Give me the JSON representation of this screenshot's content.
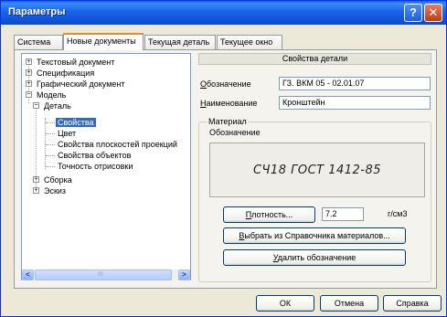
{
  "window": {
    "title": "Параметры"
  },
  "titlebar": {
    "help_label": "?",
    "close_label": "✕"
  },
  "tabs": [
    {
      "label": "Система"
    },
    {
      "label": "Новые документы"
    },
    {
      "label": "Текущая деталь"
    },
    {
      "label": "Текущее окно"
    }
  ],
  "tree": {
    "items": [
      {
        "label": "Текстовый документ",
        "expander": "+"
      },
      {
        "label": "Спецификация",
        "expander": "+"
      },
      {
        "label": "Графический документ",
        "expander": "+"
      },
      {
        "label": "Модель",
        "expander": "−"
      },
      {
        "label": "Деталь",
        "expander": "−"
      },
      {
        "label": "Свойства"
      },
      {
        "label": "Цвет"
      },
      {
        "label": "Свойства плоскостей проекций"
      },
      {
        "label": "Свойства объектов"
      },
      {
        "label": "Точность отрисовки"
      },
      {
        "label": "Сборка",
        "expander": "+"
      },
      {
        "label": "Эскиз",
        "expander": "+"
      }
    ],
    "selected": "Свойства"
  },
  "scrollbar": {
    "left_arrow": "<",
    "right_arrow": ">",
    "thumb_grip": "III"
  },
  "props": {
    "header": "Свойства детали",
    "designation_label_first": "О",
    "designation_label_rest": "бозначение",
    "designation_value": "ГЗ. ВКМ 05 - 02.01.07",
    "name_label_first": "Н",
    "name_label_rest": "аименование",
    "name_value": "Кронштейн"
  },
  "material": {
    "group_title": "Материал",
    "designation_label": "Обозначение",
    "value": "СЧ18 ГОСТ 1412-85",
    "density_button_first": "П",
    "density_button_rest": "лотность...",
    "density_value": "7.2",
    "density_unit": "г/см3",
    "choose_button_first": "В",
    "choose_button_rest": "ыбрать из Справочника материалов...",
    "delete_button_first": "У",
    "delete_button_rest": "далить обозначение"
  },
  "footer": {
    "ok_label": "ОК",
    "cancel_label": "Отмена",
    "help_label": "Справка"
  }
}
